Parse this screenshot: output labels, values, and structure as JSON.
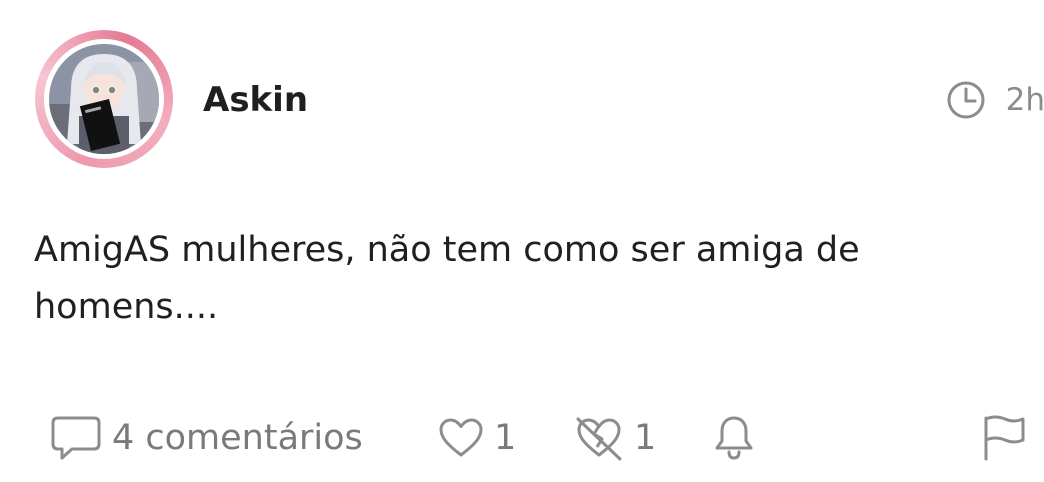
{
  "post": {
    "author": {
      "name": "Askin",
      "avatar_icon": "anime-girl-avatar"
    },
    "time": {
      "icon": "clock-icon",
      "label": "2h"
    },
    "body": "AmigAS mulheres, não tem como ser amiga de homens...."
  },
  "actions": {
    "comments": {
      "icon": "comment-icon",
      "label": "4 comentários"
    },
    "likes": {
      "icon": "heart-icon",
      "count": "1"
    },
    "dislikes": {
      "icon": "broken-heart-icon",
      "count": "1"
    },
    "notify": {
      "icon": "bell-icon"
    },
    "report": {
      "icon": "flag-icon"
    }
  },
  "colors": {
    "avatar_ring": "#ec9aae",
    "icon_gray": "#8c8c8c",
    "text": "#202020"
  }
}
